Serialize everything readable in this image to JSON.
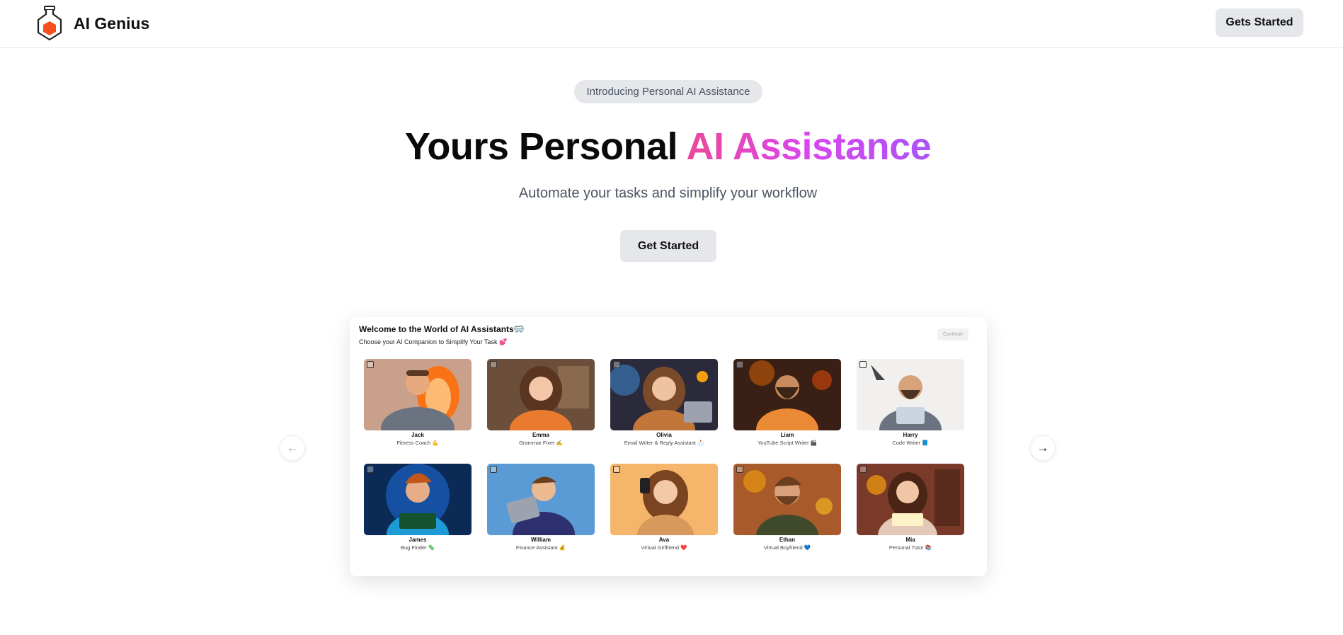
{
  "header": {
    "brand_name": "AI Genius",
    "logo_icon": "flask-hexagon-logo",
    "cta_label": "Gets Started"
  },
  "hero": {
    "badge": "Introducing Personal AI Assistance",
    "title_plain": "Yours Personal ",
    "title_highlight": "AI Assistance",
    "subtitle": "Automate your tasks and simplify your workflow",
    "cta_label": "Get Started"
  },
  "panel": {
    "title": "Welcome to the World of AI Assistants🥽",
    "subtitle": "Choose your AI Companion to Simplify Your Task 💕",
    "continue_label": "Continue",
    "assistants": [
      {
        "name": "Jack",
        "role": "Fitness Coach 💪"
      },
      {
        "name": "Emma",
        "role": "Grammar Fixer ✍️"
      },
      {
        "name": "Olivia",
        "role": "Email Writer & Reply Assistant 📩"
      },
      {
        "name": "Liam",
        "role": "YouTube Script Writer 🎬"
      },
      {
        "name": "Harry",
        "role": "Code Writer 📘"
      },
      {
        "name": "James",
        "role": "Bug Finder 🦠"
      },
      {
        "name": "William",
        "role": "Finance Assistant 💰"
      },
      {
        "name": "Ava",
        "role": "Virtual Girlfriend ❤️"
      },
      {
        "name": "Ethan",
        "role": "Virtual Boyfriend 💙"
      },
      {
        "name": "Mia",
        "role": "Personal Tutor 📚"
      }
    ]
  },
  "carousel": {
    "prev_icon": "arrow-left-icon",
    "next_icon": "arrow-right-icon"
  },
  "colors": {
    "accent_pink": "#ec4899",
    "accent_purple": "#a855f7",
    "logo_orange": "#f4511e"
  }
}
